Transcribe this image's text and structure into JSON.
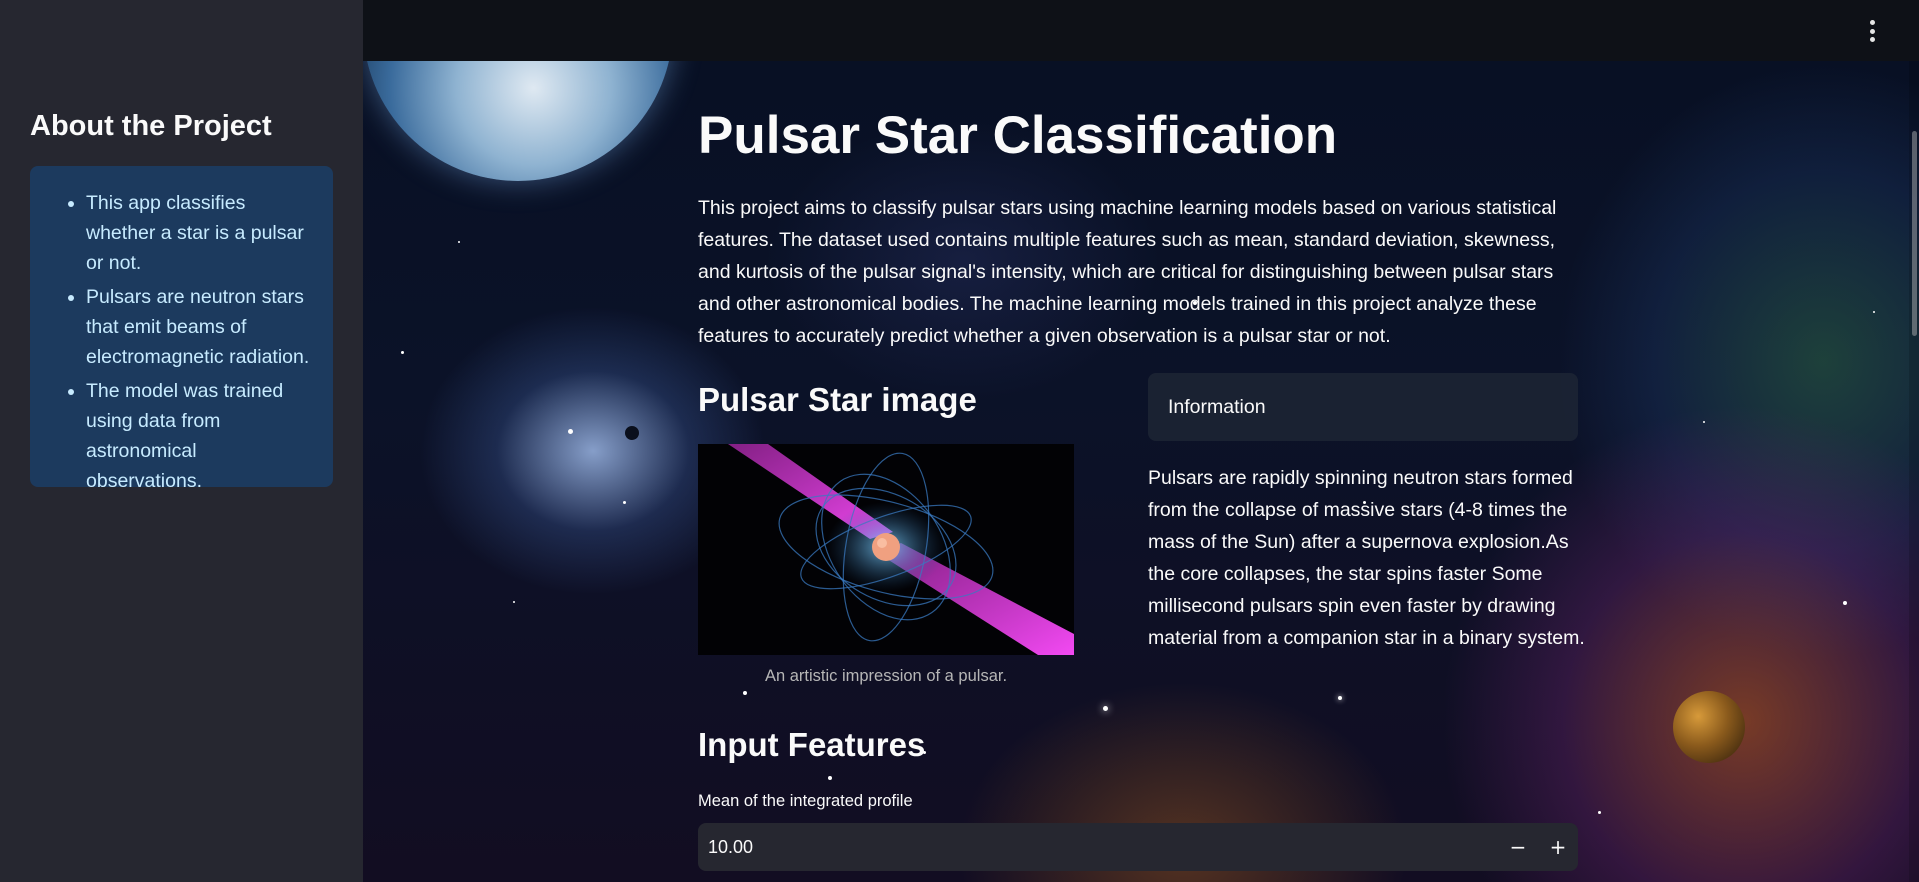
{
  "sidebar": {
    "title": "About the Project",
    "items": [
      "This app classifies whether a star is a pulsar or not.",
      "Pulsars are neutron stars that emit beams of electromagnetic radiation.",
      "The model was trained using data from astronomical observations."
    ]
  },
  "header": {
    "menu_icon": "kebab-menu-icon"
  },
  "main": {
    "title": "Pulsar Star Classification",
    "intro": "This project aims to classify pulsar stars using machine learning models based on various statistical features. The dataset used contains multiple features such as mean, standard deviation, skewness, and kurtosis of the pulsar signal's intensity, which are critical for distinguishing between pulsar stars and other astronomical bodies. The machine learning models trained in this project analyze these features to accurately predict whether a given observation is a pulsar star or not.",
    "image_heading": "Pulsar Star image",
    "image_caption": "An artistic impression of a pulsar.",
    "info_header": "Information",
    "info_text": "Pulsars are rapidly spinning neutron stars formed from the collapse of massive stars (4-8 times the mass of the Sun) after a supernova explosion.As the core collapses, the star spins faster Some millisecond pulsars spin even faster by drawing material from a companion star in a binary system.",
    "input_heading": "Input Features",
    "field_label": "Mean of the integrated profile",
    "field_value": "10.00",
    "minus": "−",
    "plus": "+"
  },
  "colors": {
    "sidebar_bg": "#262730",
    "info_box_bg": "#1c3a5e",
    "info_box_text": "#c7ebff",
    "header_bg": "#0e1117",
    "input_bg": "#262730",
    "beam": "#ff4dff"
  }
}
